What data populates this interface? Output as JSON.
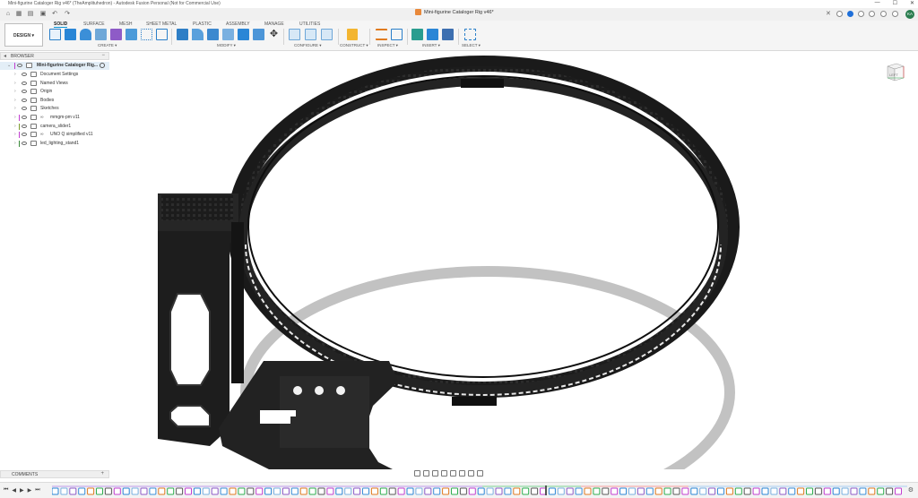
{
  "window": {
    "title": "Mini-figurine Cataloger Rig v46* (TheAmplituhedron) - Autodesk Fusion Personal (Not for Commercial Use)",
    "controls": [
      "—",
      "☐",
      "✕"
    ]
  },
  "doc_tab": {
    "label": "Mini-figurine Cataloger Rig v46*",
    "close": "✕"
  },
  "user": {
    "initials": "KA"
  },
  "ribbon": {
    "workspace": "DESIGN ▾",
    "tabs": [
      "SOLID",
      "SURFACE",
      "MESH",
      "SHEET METAL",
      "PLASTIC",
      "ASSEMBLY",
      "MANAGE",
      "UTILITIES"
    ],
    "active_tab": "SOLID",
    "groups": [
      "CREATE ▾",
      "MODIFY ▾",
      "CONFIGURE ▾",
      "CONSTRUCT ▾",
      "INSPECT ▾",
      "INSERT ▾",
      "SELECT ▾"
    ]
  },
  "browser": {
    "header": "BROWSER",
    "root": "Mini-figurine Cataloger Rig...",
    "items": [
      {
        "label": "Document Settings",
        "icon": "gear-icon"
      },
      {
        "label": "Named Views",
        "icon": "folder-icon"
      },
      {
        "label": "Origin",
        "icon": "folder-icon"
      },
      {
        "label": "Bodies",
        "icon": "folder-icon"
      },
      {
        "label": "Sketches",
        "icon": "folder-icon"
      },
      {
        "label": "mmgm-pm v11",
        "icon": "component-icon",
        "color": "#c23fd0",
        "linked": true
      },
      {
        "label": "camera_slider1",
        "icon": "component-icon",
        "color": "#7c9a2e",
        "linked": false
      },
      {
        "label": "UNO Q simplified v11",
        "icon": "component-icon",
        "color": "#c23fd0",
        "linked": true
      },
      {
        "label": "led_lighting_stand1",
        "icon": "component-icon",
        "color": "#3a8a3a",
        "linked": false
      }
    ]
  },
  "viewcube": {
    "face": "LEFT"
  },
  "comments": {
    "label": "COMMENTS",
    "add": "+"
  },
  "timeline": {
    "controls": [
      "⏮",
      "◀",
      "▶",
      "▶",
      "⏭"
    ]
  },
  "colors": {
    "accent": "#0696d7",
    "model": "#1c1c1c",
    "shadow": "#bdbdbd"
  }
}
